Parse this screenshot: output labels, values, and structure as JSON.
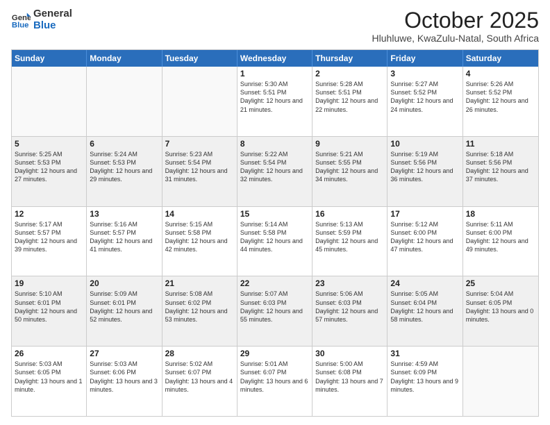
{
  "logo": {
    "line1": "General",
    "line2": "Blue"
  },
  "title": "October 2025",
  "subtitle": "Hluhluwe, KwaZulu-Natal, South Africa",
  "days_of_week": [
    "Sunday",
    "Monday",
    "Tuesday",
    "Wednesday",
    "Thursday",
    "Friday",
    "Saturday"
  ],
  "weeks": [
    [
      {
        "day": "",
        "content": ""
      },
      {
        "day": "",
        "content": ""
      },
      {
        "day": "",
        "content": ""
      },
      {
        "day": "1",
        "content": "Sunrise: 5:30 AM\nSunset: 5:51 PM\nDaylight: 12 hours and 21 minutes."
      },
      {
        "day": "2",
        "content": "Sunrise: 5:28 AM\nSunset: 5:51 PM\nDaylight: 12 hours and 22 minutes."
      },
      {
        "day": "3",
        "content": "Sunrise: 5:27 AM\nSunset: 5:52 PM\nDaylight: 12 hours and 24 minutes."
      },
      {
        "day": "4",
        "content": "Sunrise: 5:26 AM\nSunset: 5:52 PM\nDaylight: 12 hours and 26 minutes."
      }
    ],
    [
      {
        "day": "5",
        "content": "Sunrise: 5:25 AM\nSunset: 5:53 PM\nDaylight: 12 hours and 27 minutes."
      },
      {
        "day": "6",
        "content": "Sunrise: 5:24 AM\nSunset: 5:53 PM\nDaylight: 12 hours and 29 minutes."
      },
      {
        "day": "7",
        "content": "Sunrise: 5:23 AM\nSunset: 5:54 PM\nDaylight: 12 hours and 31 minutes."
      },
      {
        "day": "8",
        "content": "Sunrise: 5:22 AM\nSunset: 5:54 PM\nDaylight: 12 hours and 32 minutes."
      },
      {
        "day": "9",
        "content": "Sunrise: 5:21 AM\nSunset: 5:55 PM\nDaylight: 12 hours and 34 minutes."
      },
      {
        "day": "10",
        "content": "Sunrise: 5:19 AM\nSunset: 5:56 PM\nDaylight: 12 hours and 36 minutes."
      },
      {
        "day": "11",
        "content": "Sunrise: 5:18 AM\nSunset: 5:56 PM\nDaylight: 12 hours and 37 minutes."
      }
    ],
    [
      {
        "day": "12",
        "content": "Sunrise: 5:17 AM\nSunset: 5:57 PM\nDaylight: 12 hours and 39 minutes."
      },
      {
        "day": "13",
        "content": "Sunrise: 5:16 AM\nSunset: 5:57 PM\nDaylight: 12 hours and 41 minutes."
      },
      {
        "day": "14",
        "content": "Sunrise: 5:15 AM\nSunset: 5:58 PM\nDaylight: 12 hours and 42 minutes."
      },
      {
        "day": "15",
        "content": "Sunrise: 5:14 AM\nSunset: 5:58 PM\nDaylight: 12 hours and 44 minutes."
      },
      {
        "day": "16",
        "content": "Sunrise: 5:13 AM\nSunset: 5:59 PM\nDaylight: 12 hours and 45 minutes."
      },
      {
        "day": "17",
        "content": "Sunrise: 5:12 AM\nSunset: 6:00 PM\nDaylight: 12 hours and 47 minutes."
      },
      {
        "day": "18",
        "content": "Sunrise: 5:11 AM\nSunset: 6:00 PM\nDaylight: 12 hours and 49 minutes."
      }
    ],
    [
      {
        "day": "19",
        "content": "Sunrise: 5:10 AM\nSunset: 6:01 PM\nDaylight: 12 hours and 50 minutes."
      },
      {
        "day": "20",
        "content": "Sunrise: 5:09 AM\nSunset: 6:01 PM\nDaylight: 12 hours and 52 minutes."
      },
      {
        "day": "21",
        "content": "Sunrise: 5:08 AM\nSunset: 6:02 PM\nDaylight: 12 hours and 53 minutes."
      },
      {
        "day": "22",
        "content": "Sunrise: 5:07 AM\nSunset: 6:03 PM\nDaylight: 12 hours and 55 minutes."
      },
      {
        "day": "23",
        "content": "Sunrise: 5:06 AM\nSunset: 6:03 PM\nDaylight: 12 hours and 57 minutes."
      },
      {
        "day": "24",
        "content": "Sunrise: 5:05 AM\nSunset: 6:04 PM\nDaylight: 12 hours and 58 minutes."
      },
      {
        "day": "25",
        "content": "Sunrise: 5:04 AM\nSunset: 6:05 PM\nDaylight: 13 hours and 0 minutes."
      }
    ],
    [
      {
        "day": "26",
        "content": "Sunrise: 5:03 AM\nSunset: 6:05 PM\nDaylight: 13 hours and 1 minute."
      },
      {
        "day": "27",
        "content": "Sunrise: 5:03 AM\nSunset: 6:06 PM\nDaylight: 13 hours and 3 minutes."
      },
      {
        "day": "28",
        "content": "Sunrise: 5:02 AM\nSunset: 6:07 PM\nDaylight: 13 hours and 4 minutes."
      },
      {
        "day": "29",
        "content": "Sunrise: 5:01 AM\nSunset: 6:07 PM\nDaylight: 13 hours and 6 minutes."
      },
      {
        "day": "30",
        "content": "Sunrise: 5:00 AM\nSunset: 6:08 PM\nDaylight: 13 hours and 7 minutes."
      },
      {
        "day": "31",
        "content": "Sunrise: 4:59 AM\nSunset: 6:09 PM\nDaylight: 13 hours and 9 minutes."
      },
      {
        "day": "",
        "content": ""
      }
    ]
  ]
}
